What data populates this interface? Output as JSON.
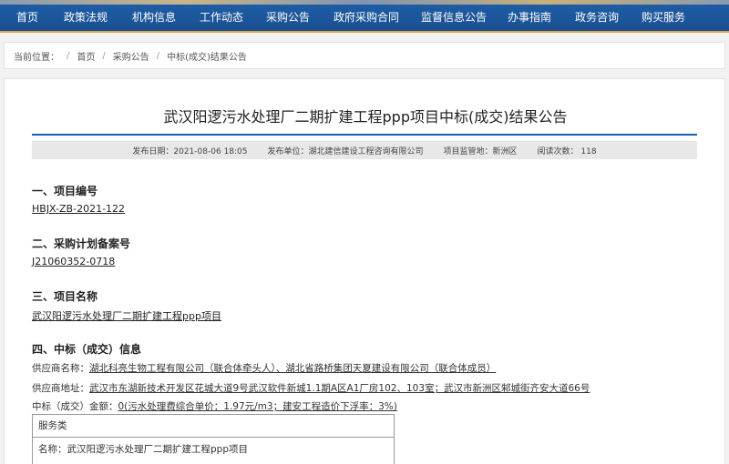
{
  "nav": {
    "items": [
      "首页",
      "政策法规",
      "机构信息",
      "工作动态",
      "采购公告",
      "政府采购合同",
      "监督信息公告",
      "办事指南",
      "政务咨询",
      "购买服务"
    ]
  },
  "breadcrumb": {
    "prefix": "当前位置：",
    "items": [
      "首页",
      "采购公告",
      "中标(成交)结果公告"
    ]
  },
  "article": {
    "title": "武汉阳逻污水处理厂二期扩建工程ppp项目中标(成交)结果公告",
    "meta": {
      "publish_date": "发布日期：2021-08-06 18:05",
      "publisher": "发布单位：湖北建信建设工程咨询有限公司",
      "supervisor": "项目监管地：新洲区",
      "views": "阅读次数： 118"
    },
    "sections": {
      "s1_heading": "一、项目编号",
      "s1_value": "HBJX-ZB-2021-122",
      "s2_heading": "二、采购计划备案号",
      "s2_value": "J21060352-0718",
      "s3_heading": "三、项目名称",
      "s3_value": "武汉阳逻污水处理厂二期扩建工程ppp项目",
      "s4_heading": "四、中标（成交）信息"
    },
    "winner": {
      "supplier_label": "供应商名称：",
      "supplier_value": "湖北科亮生物工程有限公司（联合体牵头人）、湖北省路桥集团天夏建设有限公司（联合体成员）",
      "address_label": "供应商地址：",
      "address_value": "武汉市东湖新技术开发区花城大道9号武汉软件新城1.1期A区A1厂房102、103室；武汉市新洲区邾城街齐安大道66号",
      "amount_label": "中标（成交）金额：",
      "amount_value": "0(污水处理费综合单价：1.97元/m3；建安工程造价下浮率：3%)"
    },
    "service_table": {
      "header": "服务类",
      "name_label": "名称：",
      "name_value": "武汉阳逻污水处理厂二期扩建工程ppp项目"
    }
  }
}
